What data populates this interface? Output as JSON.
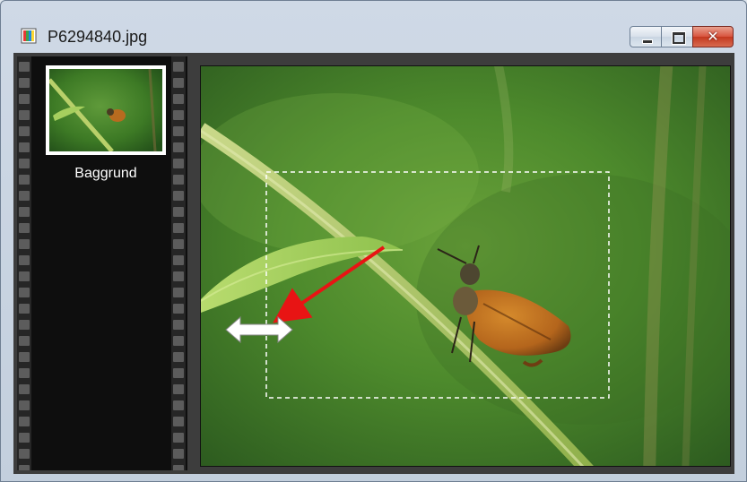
{
  "window": {
    "title": "P6294840.jpg",
    "icon": "image-file-icon",
    "controls": {
      "minimize": "minimize-icon",
      "maximize": "maximize-icon",
      "close_glyph": "✕"
    }
  },
  "filmstrip": {
    "items": [
      {
        "label": "Baggrund",
        "selected": true
      }
    ]
  },
  "colors": {
    "accent_arrow": "#e81414",
    "selection_border": "#ffffff",
    "film_background": "#0e0e0e"
  }
}
